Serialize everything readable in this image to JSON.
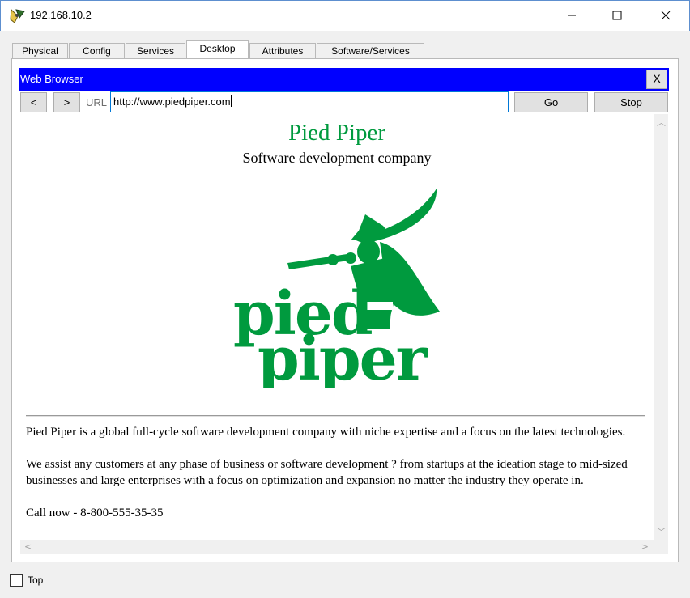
{
  "window": {
    "title": "192.168.10.2",
    "icons": {
      "app": "router-icon",
      "minimize": "minimize-icon",
      "maximize": "maximize-icon",
      "close": "close-icon"
    }
  },
  "tabs": [
    {
      "label": "Physical"
    },
    {
      "label": "Config"
    },
    {
      "label": "Services"
    },
    {
      "label": "Desktop"
    },
    {
      "label": "Attributes"
    },
    {
      "label": "Software/Services"
    }
  ],
  "browser": {
    "header_title": "Web Browser",
    "close_label": "X",
    "back_label": "<",
    "forward_label": ">",
    "url_label": "URL",
    "url_value": "http://www.piedpiper.com",
    "go_label": "Go",
    "stop_label": "Stop",
    "header_color": "#0000ff"
  },
  "page": {
    "title": "Pied Piper",
    "subtitle": "Software development company",
    "logo_line1": "pied",
    "logo_line2": "piper",
    "brand_color": "#009a3e",
    "intro": "Pied Piper is a global full-cycle software development company with niche expertise and a focus on the latest technologies.",
    "assist": "We assist any customers at any phase of business or software development ? from startups at the ideation stage to mid-sized businesses and large enterprises with a focus on optimization and expansion no matter the industry they operate in.",
    "call": "Call now - 8-800-555-35-35"
  },
  "footer": {
    "top_label": "Top"
  }
}
